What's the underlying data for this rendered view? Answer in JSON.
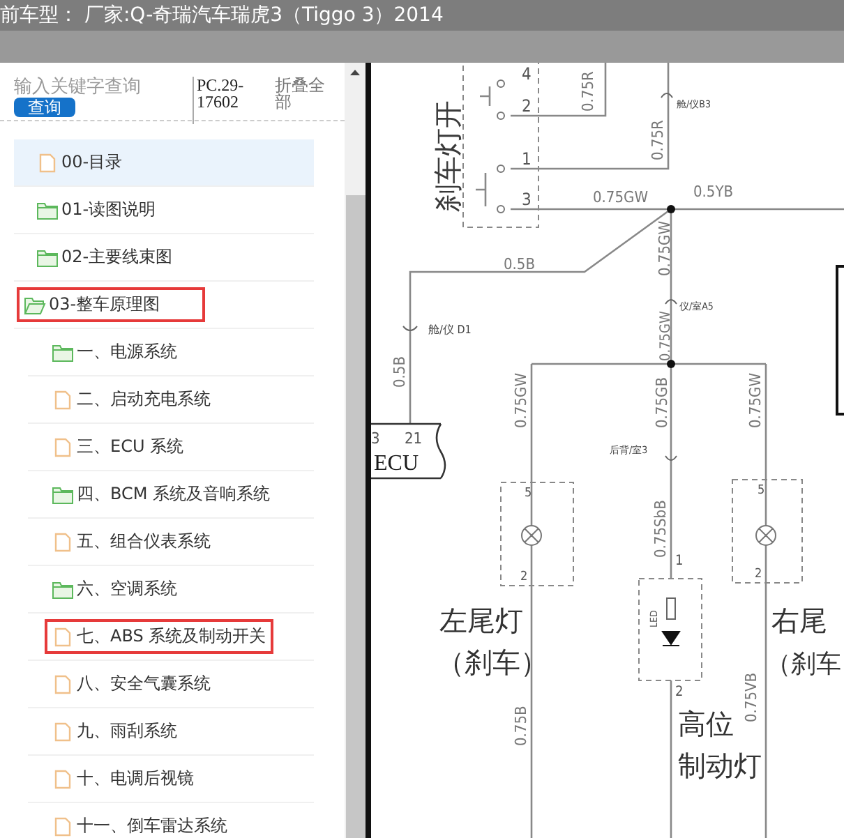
{
  "header": {
    "title": "前车型： 厂家:Q-奇瑞汽车瑞虎3（Tiggo 3）2014"
  },
  "sidebar": {
    "search": {
      "placeholder": "输入关键字查询"
    },
    "search_button": "查询",
    "code": "PC.29-17602",
    "collapse_all": "折叠全部",
    "tree": [
      {
        "label": "00-目录",
        "kind": "file",
        "selected": true,
        "expanded": false,
        "outlined": false
      },
      {
        "label": "01-读图说明",
        "kind": "folder",
        "selected": false,
        "expanded": false,
        "outlined": false
      },
      {
        "label": "02-主要线束图",
        "kind": "folder",
        "selected": false,
        "expanded": false,
        "outlined": false
      },
      {
        "label": "03-整车原理图",
        "kind": "folder",
        "selected": false,
        "expanded": true,
        "outlined": true,
        "children": [
          {
            "label": "一、电源系统",
            "kind": "folder",
            "selected": false,
            "expanded": false,
            "outlined": false
          },
          {
            "label": "二、启动充电系统",
            "kind": "file",
            "selected": false,
            "expanded": false,
            "outlined": false
          },
          {
            "label": "三、ECU 系统",
            "kind": "file",
            "selected": false,
            "expanded": false,
            "outlined": false
          },
          {
            "label": "四、BCM 系统及音响系统",
            "kind": "folder",
            "selected": false,
            "expanded": false,
            "outlined": false
          },
          {
            "label": "五、组合仪表系统",
            "kind": "file",
            "selected": false,
            "expanded": false,
            "outlined": false
          },
          {
            "label": "六、空调系统",
            "kind": "folder",
            "selected": false,
            "expanded": false,
            "outlined": false
          },
          {
            "label": "七、ABS 系统及制动开关",
            "kind": "file",
            "selected": false,
            "expanded": false,
            "outlined": true
          },
          {
            "label": "八、安全气囊系统",
            "kind": "file",
            "selected": false,
            "expanded": false,
            "outlined": false
          },
          {
            "label": "九、雨刮系统",
            "kind": "file",
            "selected": false,
            "expanded": false,
            "outlined": false
          },
          {
            "label": "十、电调后视镜",
            "kind": "file",
            "selected": false,
            "expanded": false,
            "outlined": false
          },
          {
            "label": "十一、倒车雷达系统",
            "kind": "file",
            "selected": false,
            "expanded": false,
            "outlined": false
          }
        ]
      }
    ]
  },
  "diagram": {
    "labels": [
      {
        "kind": "title",
        "text": "刹车灯开"
      },
      {
        "kind": "pin",
        "text": "4"
      },
      {
        "kind": "pin",
        "text": "2"
      },
      {
        "kind": "pin",
        "text": "1"
      },
      {
        "kind": "pin",
        "text": "3"
      },
      {
        "kind": "wire",
        "text": "0.75R"
      },
      {
        "kind": "wire",
        "text": "0.75R"
      },
      {
        "kind": "connector",
        "text": "舱/仪B3"
      },
      {
        "kind": "wire",
        "text": "0.75GW"
      },
      {
        "kind": "wire",
        "text": "0.5YB"
      },
      {
        "kind": "wire",
        "text": "0.5B"
      },
      {
        "kind": "wire",
        "text": "0.75GW"
      },
      {
        "kind": "connector",
        "text": "仪/室A5"
      },
      {
        "kind": "wire",
        "text": "0.75GW"
      },
      {
        "kind": "connector",
        "text": "舱/仪 D1"
      },
      {
        "kind": "wire",
        "text": "0.5B"
      },
      {
        "kind": "wire",
        "text": "0.75GW"
      },
      {
        "kind": "wire",
        "text": "0.75GB"
      },
      {
        "kind": "wire",
        "text": "0.75GW"
      },
      {
        "kind": "pin",
        "text": "3"
      },
      {
        "kind": "pin",
        "text": "21"
      },
      {
        "kind": "module",
        "text": "ECU"
      },
      {
        "kind": "connector",
        "text": "后背/室3"
      },
      {
        "kind": "pin",
        "text": "5"
      },
      {
        "kind": "pin",
        "text": "5"
      },
      {
        "kind": "wire",
        "text": "0.75SbB"
      },
      {
        "kind": "pin",
        "text": "1"
      },
      {
        "kind": "pin",
        "text": "2"
      },
      {
        "kind": "pin",
        "text": "2"
      },
      {
        "kind": "pin",
        "text": "LED"
      },
      {
        "kind": "pin",
        "text": "2"
      },
      {
        "kind": "name",
        "text": "左尾灯"
      },
      {
        "kind": "name",
        "text": "（刹车）"
      },
      {
        "kind": "name",
        "text": "右尾"
      },
      {
        "kind": "name",
        "text": "（刹车"
      },
      {
        "kind": "name",
        "text": "高位"
      },
      {
        "kind": "name",
        "text": "制动灯"
      },
      {
        "kind": "wire",
        "text": "0.75B"
      },
      {
        "kind": "wire",
        "text": "0.75VB"
      }
    ]
  }
}
